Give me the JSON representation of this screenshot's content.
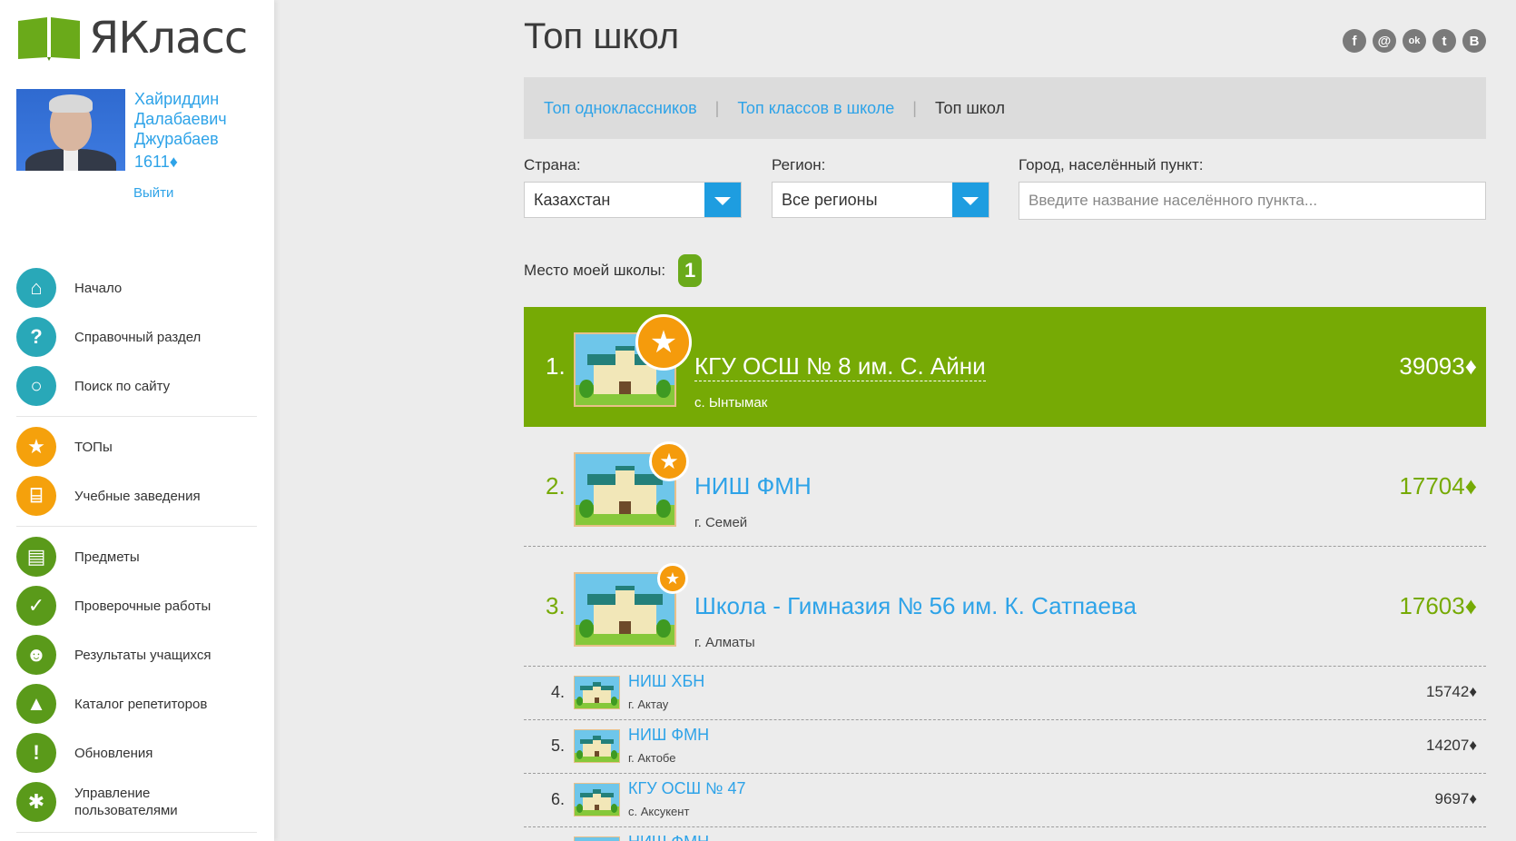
{
  "app": {
    "logo_text": "ЯКласс"
  },
  "profile": {
    "name": "Хайриддин Далабаевич Джурабаев",
    "points": "1611♦",
    "logout": "Выйти"
  },
  "menu": {
    "group1": [
      {
        "label": "Начало",
        "icon": "home-icon",
        "glyph": "⌂"
      },
      {
        "label": "Справочный раздел",
        "icon": "question-icon",
        "glyph": "?"
      },
      {
        "label": "Поиск по сайту",
        "icon": "search-icon",
        "glyph": "○"
      }
    ],
    "group2": [
      {
        "label": "ТОПы",
        "icon": "star-icon",
        "glyph": "★"
      },
      {
        "label": "Учебные заведения",
        "icon": "institution-icon",
        "glyph": "⌸"
      }
    ],
    "group3": [
      {
        "label": "Предметы",
        "icon": "book-icon",
        "glyph": "▤"
      },
      {
        "label": "Проверочные работы",
        "icon": "check-icon",
        "glyph": "✓"
      },
      {
        "label": "Результаты учащихся",
        "icon": "people-icon",
        "glyph": "☻"
      },
      {
        "label": "Каталог репетиторов",
        "icon": "graduation-cap-icon",
        "glyph": "▲"
      },
      {
        "label": "Обновления",
        "icon": "exclamation-icon",
        "glyph": "!"
      },
      {
        "label": "Управление пользователями",
        "icon": "user-management-icon",
        "glyph": "✱"
      }
    ]
  },
  "page": {
    "title": "Топ школ"
  },
  "social": [
    {
      "name": "facebook-icon",
      "glyph": "f"
    },
    {
      "name": "mail-icon",
      "glyph": "@"
    },
    {
      "name": "odnoklassniki-icon",
      "glyph": "ok"
    },
    {
      "name": "twitter-icon",
      "glyph": "t"
    },
    {
      "name": "vkontakte-icon",
      "glyph": "B"
    }
  ],
  "tabs": {
    "classmates": "Топ одноклассников",
    "classes": "Топ классов в школе",
    "schools": "Топ школ",
    "separator": "|"
  },
  "filters": {
    "country_label": "Страна:",
    "country_value": "Казахстан",
    "region_label": "Регион:",
    "region_value": "Все регионы",
    "city_label": "Город, населённый пункт:",
    "city_placeholder": "Введите название населённого пункта..."
  },
  "my_place": {
    "label": "Место моей школы:",
    "value": "1"
  },
  "ranking": [
    {
      "rank": "1.",
      "name": "КГУ ОСШ № 8 им. С. Айни",
      "city": "с. Ынтымак",
      "score": "39093♦"
    },
    {
      "rank": "2.",
      "name": "НИШ ФМН",
      "city": "г. Семей",
      "score": "17704♦"
    },
    {
      "rank": "3.",
      "name": "Школа - Гимназия № 56 им. К. Сатпаева",
      "city": "г. Алматы",
      "score": "17603♦"
    },
    {
      "rank": "4.",
      "name": "НИШ ХБН",
      "city": "г. Актау",
      "score": "15742♦"
    },
    {
      "rank": "5.",
      "name": "НИШ ФМН",
      "city": "г. Актобе",
      "score": "14207♦"
    },
    {
      "rank": "6.",
      "name": "КГУ ОСШ № 47",
      "city": "с. Аксукент",
      "score": "9697♦"
    },
    {
      "rank": "",
      "name": "НИШ ФМН",
      "city": "",
      "score": ""
    }
  ],
  "colors": {
    "brand_green": "#76aa05",
    "link_blue": "#2ea3e8",
    "accent_orange": "#f59b0c",
    "teal": "#29a8b8"
  }
}
